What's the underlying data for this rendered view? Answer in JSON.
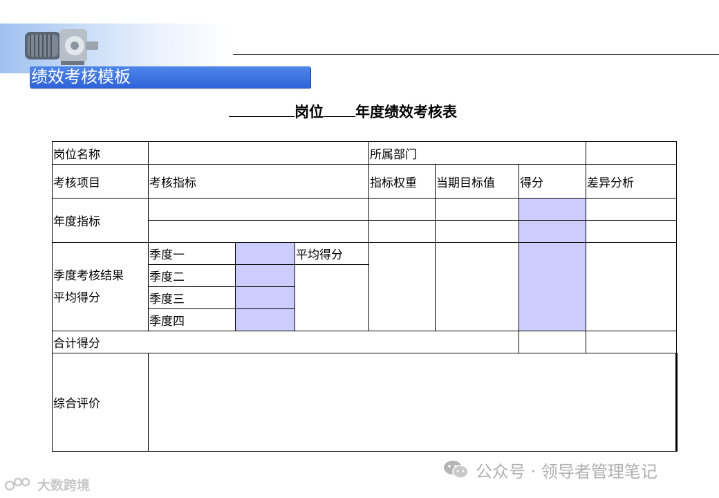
{
  "header": {
    "title": "绩效考核模板"
  },
  "form": {
    "title_part1": "岗位",
    "title_part2": "年度绩效考核表",
    "rows": {
      "position_name": "岗位名称",
      "department": "所属部门",
      "assessment_item": "考核项目",
      "assessment_indicator": "考核指标",
      "indicator_weight": "指标权重",
      "target_value": "当期目标值",
      "score": "得分",
      "variance_analysis": "差异分析",
      "annual_indicator": "年度指标",
      "quarterly_result_line1": "季度考核结果",
      "quarterly_result_line2": "平均得分",
      "quarters": [
        "季度一",
        "季度二",
        "季度三",
        "季度四"
      ],
      "average_score": "平均得分",
      "total_score": "合计得分",
      "overall_evaluation": "综合评价"
    },
    "shade_color": "#ccccff"
  },
  "watermarks": {
    "right": "公众号 · 领导者管理笔记",
    "left": "大数跨境",
    "wechat_icon": "wechat-icon",
    "logo_icon": "dashu-logo-icon"
  }
}
